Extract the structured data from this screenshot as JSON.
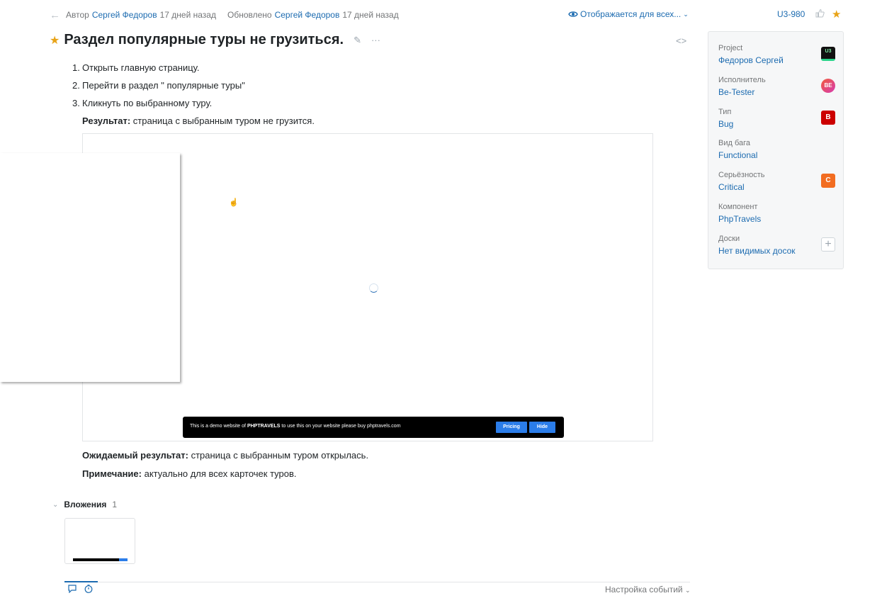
{
  "meta": {
    "author_prefix": "Автор",
    "author_name": "Сергей Федоров",
    "author_time": "17 дней назад",
    "updated_prefix": "Обновлено",
    "updated_name": "Сергей Федоров",
    "updated_time": "17 дней назад",
    "visibility": "Отображается для всех...",
    "issue_id": "U3-980"
  },
  "issue": {
    "title": "Раздел популярные туры не грузиться.",
    "steps": [
      {
        "num": "1.",
        "text": "Открыть главную страницу."
      },
      {
        "num": "2.",
        "text": "Перейти в раздел \" популярные туры\""
      },
      {
        "num": "3.",
        "text": "Кликнуть по выбранному туру."
      }
    ],
    "result_label": "Результат:",
    "result_text": " страница с выбранным туром не грузится.",
    "expected_label": "Ожидаемый результат:",
    "expected_text": " страница с выбранным туром открылась.",
    "note_label": "Примечание:",
    "note_text": " актуально для всех карточек туров."
  },
  "screenshot": {
    "banner_text_prefix": "This is a demo website of ",
    "banner_brand": "PHPTRAVELS",
    "banner_text_suffix": " to use this on your website please buy phptravels.com",
    "pricing_button": "Pricing",
    "hide_button": "Hide"
  },
  "attachments": {
    "label": "Вложения",
    "count": "1"
  },
  "footer": {
    "events_settings": "Настройка событий"
  },
  "sidebar": {
    "fields": [
      {
        "label": "Project",
        "value": "Федоров Сергей",
        "badge": "U3",
        "badge_color": "#111111"
      },
      {
        "label": "Исполнитель",
        "value": "Be-Tester",
        "badge": "BE",
        "badge_color": "#e8457a"
      },
      {
        "label": "Тип",
        "value": "Bug",
        "badge": "B",
        "badge_color": "#cc0000"
      },
      {
        "label": "Вид бага",
        "value": "Functional",
        "badge": "",
        "badge_color": ""
      },
      {
        "label": "Серьёзность",
        "value": "Critical",
        "badge": "C",
        "badge_color": "#f26d21"
      },
      {
        "label": "Компонент",
        "value": "PhpTravels",
        "badge": "",
        "badge_color": ""
      },
      {
        "label": "Доски",
        "value": "Нет видимых досок",
        "badge": "+",
        "badge_color": ""
      }
    ]
  },
  "colors": {
    "link": "#1c6bb0",
    "star": "#e8a317",
    "accent_button": "#2b7de9"
  }
}
